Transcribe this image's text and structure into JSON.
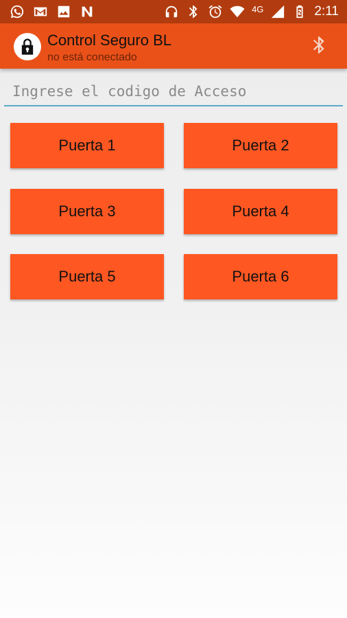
{
  "status_bar": {
    "left_icons": [
      "whatsapp-icon",
      "gmail-icon",
      "gallery-icon",
      "notification-icon"
    ],
    "right_icons": [
      "headphones-icon",
      "bluetooth-icon",
      "alarm-icon",
      "wifi-icon",
      "signal-icon",
      "battery-icon"
    ],
    "network_type": "4G",
    "time": "2:11"
  },
  "app_bar": {
    "title": "Control Seguro BL",
    "subtitle": "no está conectado",
    "logo_icon": "lock-icon",
    "action_icon": "bluetooth-icon",
    "color": "#ea5119"
  },
  "code_input": {
    "placeholder": "Ingrese el codigo de Acceso",
    "value": ""
  },
  "doors": [
    {
      "label": "Puerta 1"
    },
    {
      "label": "Puerta 2"
    },
    {
      "label": "Puerta 3"
    },
    {
      "label": "Puerta 4"
    },
    {
      "label": "Puerta 5"
    },
    {
      "label": "Puerta 6"
    }
  ],
  "colors": {
    "status_bar": "#b23c0f",
    "button": "#ff5722",
    "input_underline": "#5aa9c7"
  }
}
